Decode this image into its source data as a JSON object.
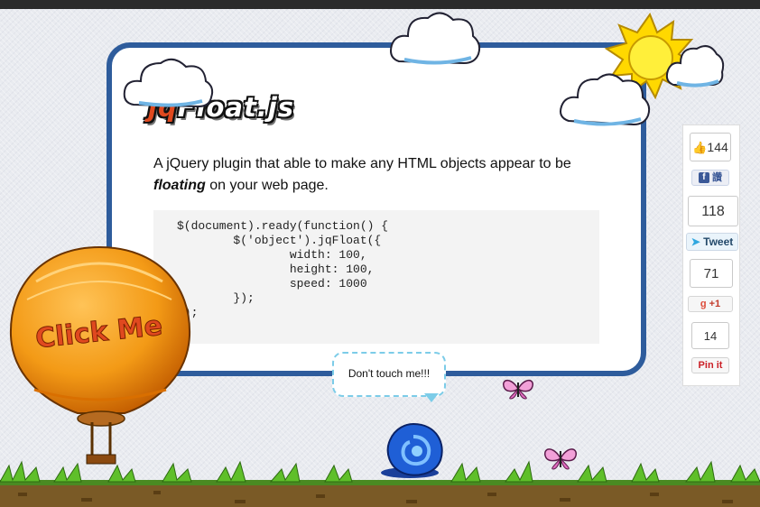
{
  "title": {
    "prefix": "jq",
    "suffix": "Float.js"
  },
  "description": {
    "before": "A jQuery plugin that able to make any HTML objects appear to be ",
    "emphasis": "floating",
    "after": " on your web page."
  },
  "code_lines": [
    "$(document).ready(function() {",
    "        $('object').jqFloat({",
    "                width: 100,",
    "                height: 100,",
    "                speed: 1000",
    "        });",
    "});"
  ],
  "balloon": {
    "label": "Click Me"
  },
  "bubble": {
    "text": "Don't touch me!!!"
  },
  "social": {
    "facebook": {
      "count": "144",
      "label": "讚"
    },
    "twitter": {
      "count": "118",
      "label": "Tweet"
    },
    "google": {
      "count": "71",
      "label": "+1"
    },
    "pinterest": {
      "count": "14",
      "label": "Pin it"
    }
  },
  "colors": {
    "card_border": "#2e5c9c",
    "balloon": "#f39a16",
    "snail": "#1f5fd6",
    "accent": "#e0491f"
  }
}
